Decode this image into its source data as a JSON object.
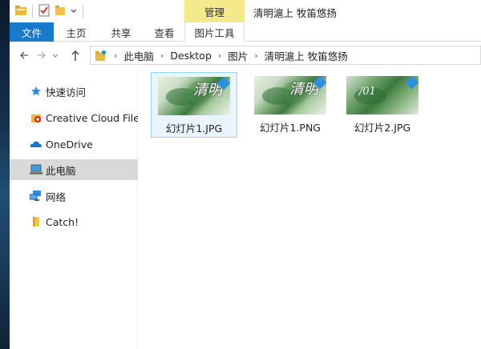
{
  "window": {
    "title": "清明滬上 牧笛悠扬",
    "contextual_tab": "管理"
  },
  "ribbon": {
    "tabs": [
      "文件",
      "主页",
      "共享",
      "查看",
      "图片工具"
    ]
  },
  "address": {
    "crumbs": [
      "此电脑",
      "Desktop",
      "图片",
      "清明滬上 牧笛悠扬"
    ]
  },
  "navpane": {
    "items": [
      {
        "label": "快速访问",
        "icon": "star-icon"
      },
      {
        "label": "Creative Cloud Files",
        "icon": "creative-cloud-icon"
      },
      {
        "label": "OneDrive",
        "icon": "onedrive-cloud-icon"
      },
      {
        "label": "此电脑",
        "icon": "computer-icon"
      },
      {
        "label": "网络",
        "icon": "network-icon"
      },
      {
        "label": "Catch!",
        "icon": "folder-icon"
      }
    ]
  },
  "files": [
    {
      "name": "幻灯片1.JPG",
      "thumb_text": "清明"
    },
    {
      "name": "幻灯片1.PNG",
      "thumb_text": "清明"
    },
    {
      "name": "幻灯片2.JPG",
      "thumb_text": "/01"
    }
  ],
  "colors": {
    "file_tab": "#1979ca",
    "manage_tab": "#f2ea8b",
    "selection_border": "#99d1ff",
    "nav_selected": "#d9d9d9"
  }
}
